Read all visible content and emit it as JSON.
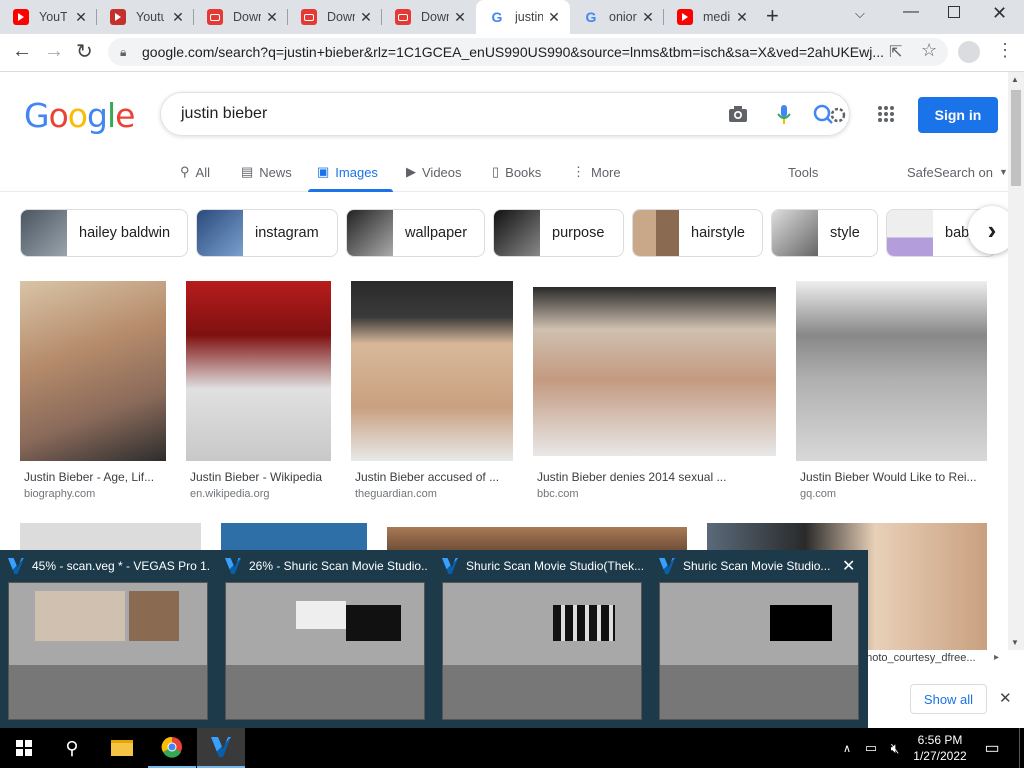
{
  "browser": {
    "tabs": [
      {
        "title": "YouTu",
        "favicon": "youtube-icon"
      },
      {
        "title": "Youtu",
        "favicon": "youtube-icon"
      },
      {
        "title": "Dowr",
        "favicon": "download-icon"
      },
      {
        "title": "Dowr",
        "favicon": "download-icon"
      },
      {
        "title": "Dowr",
        "favicon": "download-icon"
      },
      {
        "title": "justin",
        "favicon": "google-icon"
      },
      {
        "title": "onior",
        "favicon": "google-icon"
      },
      {
        "title": "medi",
        "favicon": "youtube-icon"
      }
    ],
    "new_tab": "+",
    "url": "google.com/search?q=justin+bieber&rlz=1C1GCEA_enUS990US990&source=lnms&tbm=isch&sa=X&ved=2ahUKEwj..."
  },
  "google": {
    "logo": "Google",
    "query": "justin bieber",
    "signin": "Sign in",
    "nav": [
      "All",
      "News",
      "Images",
      "Videos",
      "Books",
      "More"
    ],
    "tools": "Tools",
    "safesearch": "SafeSearch on",
    "chips": [
      "hailey baldwin",
      "instagram",
      "wallpaper",
      "purpose",
      "hairstyle",
      "style",
      "baby"
    ],
    "results": [
      {
        "caption": "Justin Bieber - Age, Lif...",
        "source": "biography.com"
      },
      {
        "caption": "Justin Bieber - Wikipedia",
        "source": "en.wikipedia.org"
      },
      {
        "caption": "Justin Bieber accused of ...",
        "source": "theguardian.com"
      },
      {
        "caption": "Justin Bieber denies 2014 sexual ...",
        "source": "bbc.com"
      },
      {
        "caption": "Justin Bieber Would Like to Rei...",
        "source": "gq.com"
      }
    ],
    "download_file": "photo_courtesy_dfree...",
    "show_all": "Show all"
  },
  "thumbnails": [
    {
      "title": "45% - scan.veg * - VEGAS Pro 1..."
    },
    {
      "title": "26% - Shuric Scan Movie Studio..."
    },
    {
      "title": "Shuric Scan Movie Studio(Thek..."
    },
    {
      "title": "Shuric Scan Movie Studio..."
    }
  ],
  "taskbar": {
    "time": "6:56 PM",
    "date": "1/27/2022"
  },
  "colors": {
    "accent": "#1a73e8",
    "chrome_tabs": "#dee1e6",
    "taskbar": "#000000",
    "thumb_popup": "#1c3a4a"
  }
}
